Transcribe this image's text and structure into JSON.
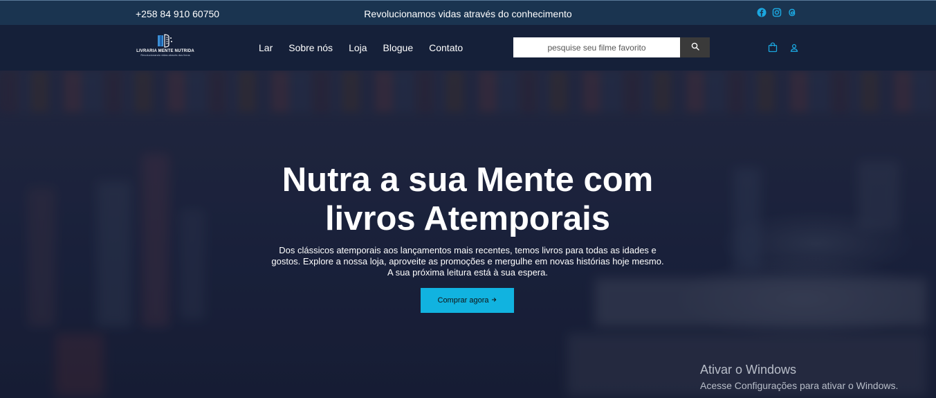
{
  "topbar": {
    "phone": "+258 84 910 60750",
    "tagline": "Revolucionamos vidas através do conhecimento",
    "social_icons": [
      "facebook-icon",
      "instagram-icon",
      "threads-icon"
    ],
    "accent": "#1ba7e0"
  },
  "logo": {
    "name": "LIVRARIA MENTE NUTRIDA",
    "subtitle": "Revolucionando vidas através dos livros"
  },
  "menu": {
    "items": [
      "Lar",
      "Sobre nós",
      "Loja",
      "Blogue",
      "Contato"
    ]
  },
  "search": {
    "placeholder": "pesquise seu filme favorito",
    "icon": "search-icon"
  },
  "nav_icons": [
    "shopping-bag-icon",
    "user-icon"
  ],
  "hero": {
    "title_line1": "Nutra a sua Mente com",
    "title_line2": "livros Atemporais",
    "description_line1": "Dos clássicos atemporais aos lançamentos mais recentes, temos livros para todas as idades e",
    "description_line2": "gostos. Explore a nossa loja, aproveite as promoções e mergulhe em novas histórias hoje mesmo.",
    "description_line3": "A sua próxima leitura está à sua espera.",
    "button_label": "Comprar agora",
    "button_icon": "arrow-right-icon",
    "button_color": "#11b3e0"
  },
  "windows_watermark": {
    "title": "Ativar o Windows",
    "subtitle": "Acesse Configurações para ativar o Windows."
  }
}
